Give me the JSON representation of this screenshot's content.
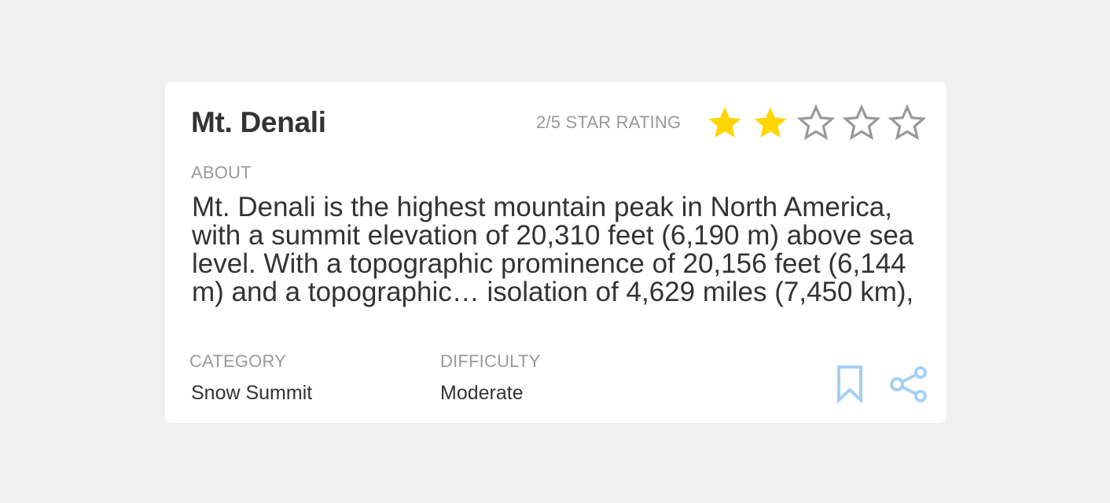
{
  "card": {
    "title": "Mt. Denali",
    "rating": {
      "label": "2/5 STAR RATING",
      "value": 2,
      "max": 5,
      "filled_color": "#FFD600",
      "empty_color": "#999999"
    },
    "about": {
      "label": "ABOUT",
      "text": "Mt. Denali is the highest mountain peak in North America, with a summit elevation of 20,310 feet (6,190 m) above sea level. With a topographic prominence of 20,156 feet (6,144 m) and a topographic… isolation of 4,629 miles (7,450 km),"
    },
    "category": {
      "label": "CATEGORY",
      "value": "Snow Summit"
    },
    "difficulty": {
      "label": "DIFFICULTY",
      "value": "Moderate"
    },
    "actions": {
      "bookmark_icon": "bookmark-icon",
      "share_icon": "share-icon",
      "icon_color": "#A6D0F5"
    }
  }
}
